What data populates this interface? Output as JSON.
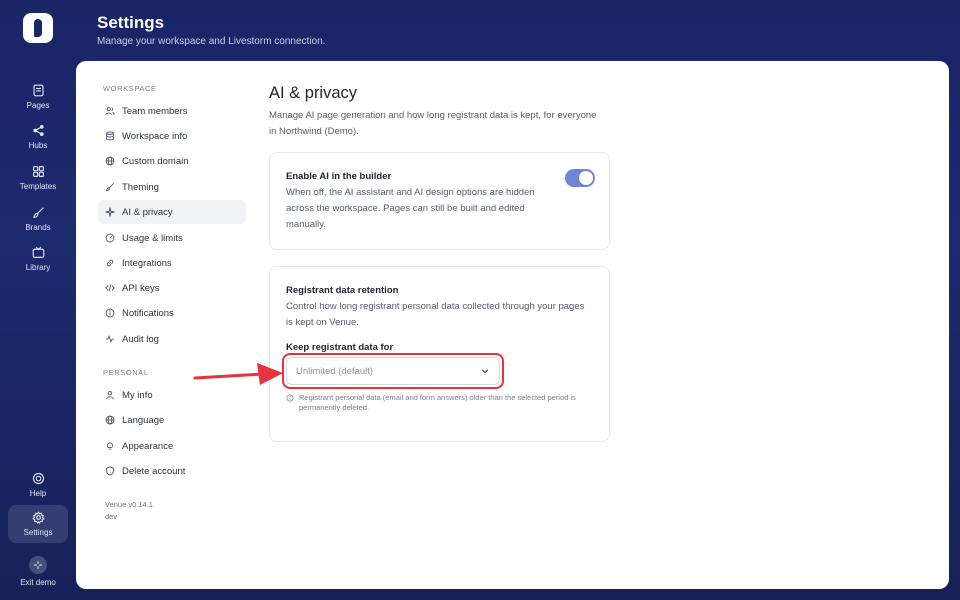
{
  "rail": {
    "items": [
      {
        "label": "Pages",
        "icon": "pages-icon"
      },
      {
        "label": "Hubs",
        "icon": "share-icon"
      },
      {
        "label": "Templates",
        "icon": "grid-icon"
      },
      {
        "label": "Brands",
        "icon": "brush-icon"
      },
      {
        "label": "Library",
        "icon": "tv-icon"
      }
    ],
    "bottom": [
      {
        "label": "Help",
        "icon": "lifebuoy-icon"
      },
      {
        "label": "Settings",
        "icon": "gear-icon"
      },
      {
        "label": "Exit demo",
        "icon": "exit-icon"
      }
    ]
  },
  "header": {
    "title": "Settings",
    "subtitle": "Manage your workspace and Livestorm connection."
  },
  "nav": {
    "workspace_label": "WORKSPACE",
    "workspace": [
      {
        "label": "Team members",
        "icon": "users-icon"
      },
      {
        "label": "Workspace info",
        "icon": "database-icon"
      },
      {
        "label": "Custom domain",
        "icon": "globe-icon"
      },
      {
        "label": "Theming",
        "icon": "brush-icon"
      },
      {
        "label": "AI & privacy",
        "icon": "sparkle-icon"
      },
      {
        "label": "Usage & limits",
        "icon": "gauge-icon"
      },
      {
        "label": "Integrations",
        "icon": "link-icon"
      },
      {
        "label": "API keys",
        "icon": "code-icon"
      },
      {
        "label": "Notifications",
        "icon": "info-icon"
      },
      {
        "label": "Audit log",
        "icon": "activity-icon"
      }
    ],
    "personal_label": "PERSONAL",
    "personal": [
      {
        "label": "My info",
        "icon": "user-icon"
      },
      {
        "label": "Language",
        "icon": "globe-icon"
      },
      {
        "label": "Appearance",
        "icon": "bulb-icon"
      },
      {
        "label": "Delete account",
        "icon": "shield-icon"
      }
    ],
    "version": "Venue v0.14.1",
    "env": "dev"
  },
  "content": {
    "title": "AI & privacy",
    "description": "Manage AI page generation and how long registrant data is kept, for everyone in Northwind (Demo).",
    "ai_card": {
      "title": "Enable AI in the builder",
      "text": "When off, the AI assistant and AI design options are hidden across the workspace. Pages can still be built and edited manually.",
      "enabled": true
    },
    "retention_card": {
      "title": "Registrant data retention",
      "text": "Control how long registrant personal data collected through your pages is kept on Venue.",
      "field_label": "Keep registrant data for",
      "selected": "Unlimited (default)",
      "hint": "Registrant personal data (email and form answers) older than the selected period is permanently deleted."
    }
  },
  "colors": {
    "background": "#1a2566",
    "accent": "#6f86d6",
    "highlight": "#e5343f"
  }
}
